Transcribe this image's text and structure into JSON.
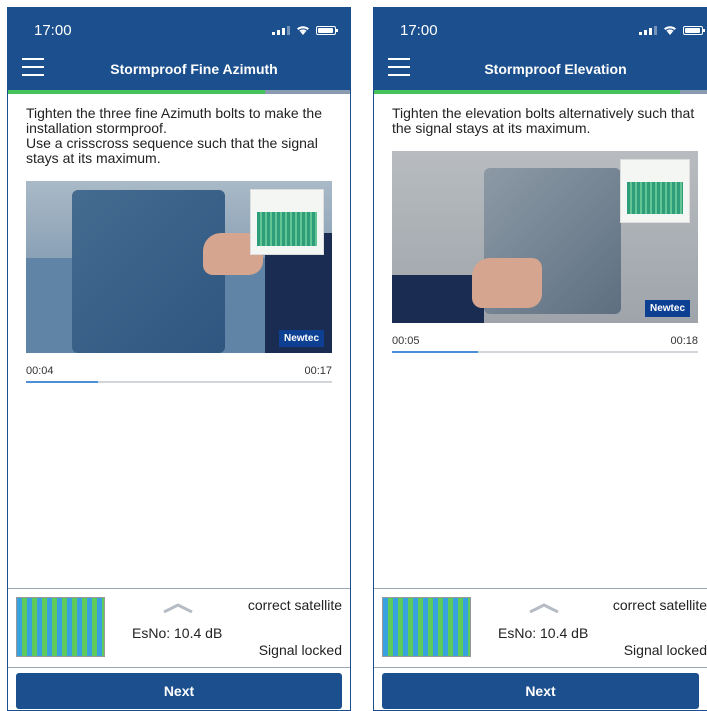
{
  "screens": [
    {
      "status_time": "17:00",
      "title": "Stormproof Fine Azimuth",
      "step_progress": 0.75,
      "instructions": [
        "Tighten the three fine Azimuth bolts to make the installation stormproof.",
        "Use a crisscross sequence such that the signal stays at its maximum."
      ],
      "video": {
        "current_time": "00:04",
        "duration": "00:17",
        "played_fraction": 0.235,
        "logo": "Newtec"
      },
      "signal": {
        "esno": "EsNo: 10.4 dB",
        "satellite": "correct satellite",
        "lock": "Signal locked"
      },
      "next_label": "Next"
    },
    {
      "status_time": "17:00",
      "title": "Stormproof Elevation",
      "step_progress": 0.92,
      "instructions": [
        "Tighten the elevation bolts alternatively such that the signal stays at its maximum."
      ],
      "video": {
        "current_time": "00:05",
        "duration": "00:18",
        "played_fraction": 0.28,
        "logo": "Newtec"
      },
      "signal": {
        "esno": "EsNo: 10.4 dB",
        "satellite": "correct satellite",
        "lock": "Signal locked"
      },
      "next_label": "Next"
    }
  ],
  "icons": {
    "menu": "hamburger-menu-icon",
    "chevron": "chevron-up-icon",
    "signal_strength": "cellular-signal-icon",
    "wifi": "wifi-icon",
    "battery": "battery-icon"
  },
  "colors": {
    "primary": "#1b4f8d",
    "progress": "#45c25b",
    "scrub_played": "#4c8fd6"
  }
}
